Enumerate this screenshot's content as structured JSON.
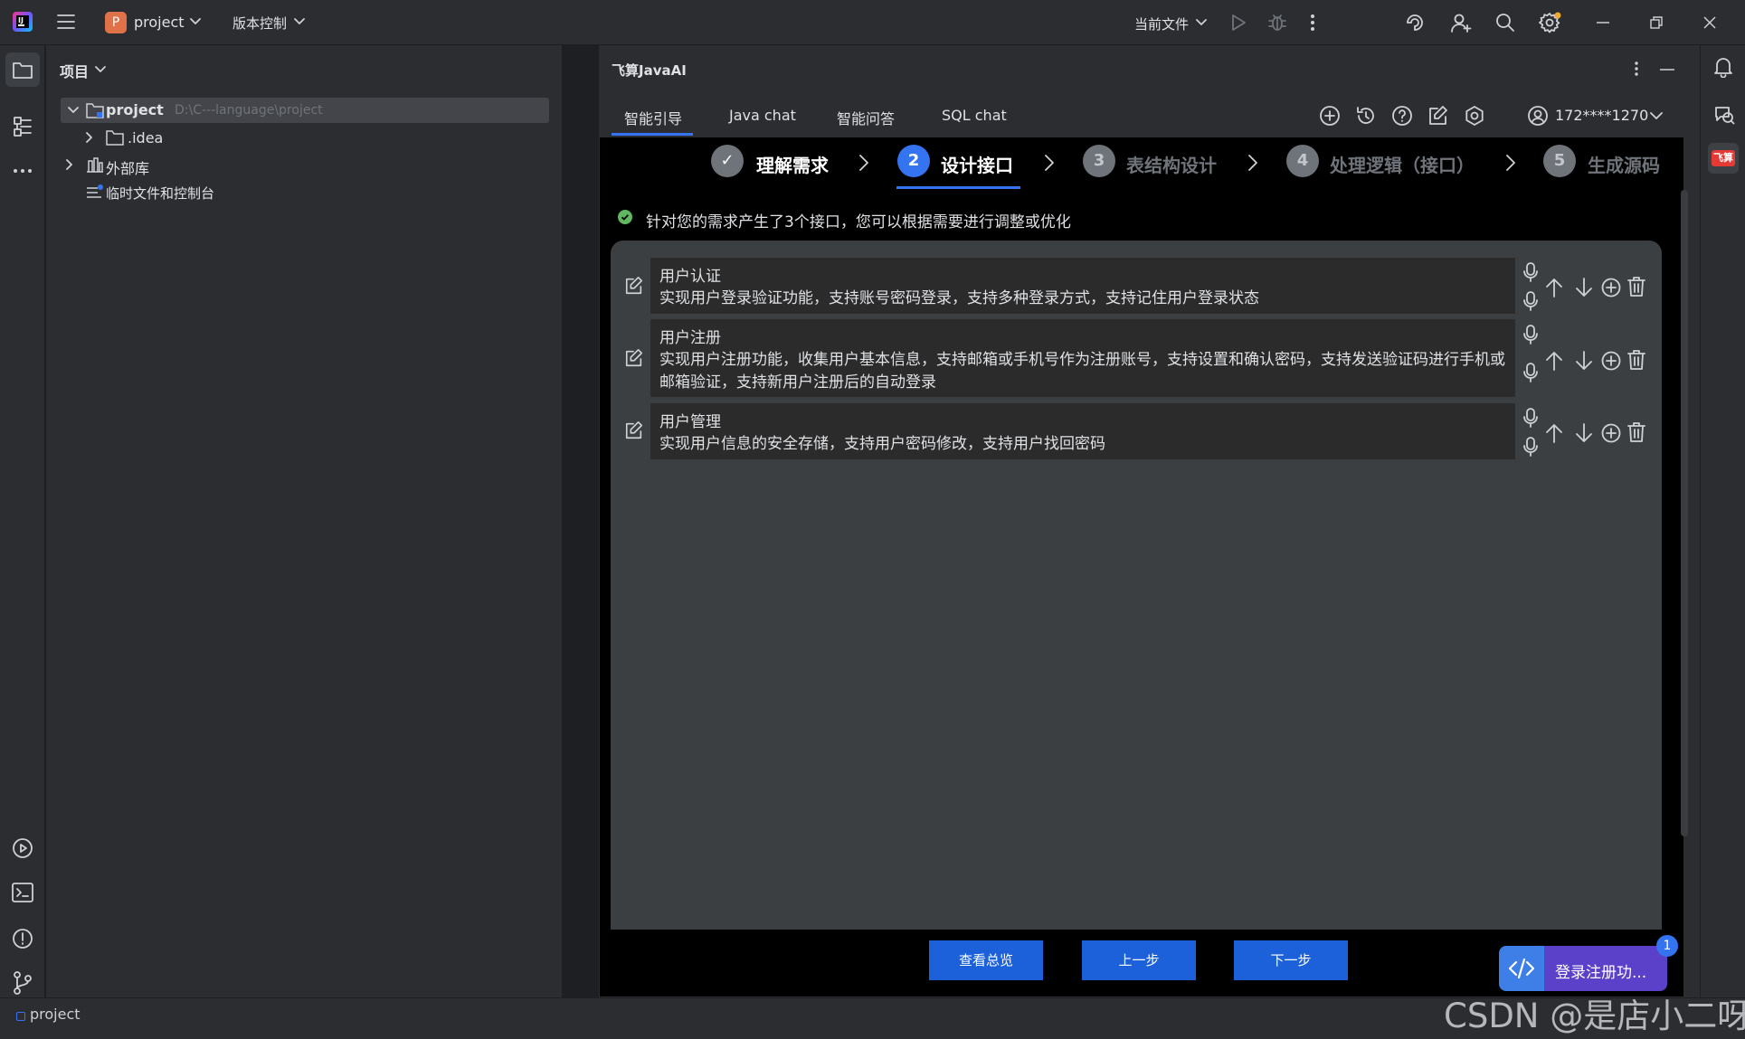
{
  "titlebar": {
    "project_badge": "P",
    "project_name": "project",
    "vcs_label": "版本控制",
    "run_config": "当前文件"
  },
  "project_panel": {
    "header": "项目",
    "tree": [
      {
        "label": "project",
        "path": "D:\\C---language\\project"
      },
      {
        "label": ".idea"
      },
      {
        "label": "外部库"
      },
      {
        "label": "临时文件和控制台"
      }
    ]
  },
  "ai_panel": {
    "title": "飞算JavaAI",
    "tabs": [
      "智能引导",
      "Java chat",
      "智能问答",
      "SQL chat"
    ],
    "active_tab": "智能引导",
    "user": "172****1270",
    "steps": [
      {
        "num": "✓",
        "label": "理解需求",
        "state": "done"
      },
      {
        "num": "2",
        "label": "设计接口",
        "state": "active"
      },
      {
        "num": "3",
        "label": "表结构设计",
        "state": "pending"
      },
      {
        "num": "4",
        "label": "处理逻辑（接口）",
        "state": "pending"
      },
      {
        "num": "5",
        "label": "生成源码",
        "state": "pending"
      }
    ],
    "notice": "针对您的需求产生了3个接口，您可以根据需要进行调整或优化",
    "interfaces": [
      {
        "title": "用户认证",
        "desc": "实现用户登录验证功能，支持账号密码登录，支持多种登录方式，支持记住用户登录状态"
      },
      {
        "title": "用户注册",
        "desc": "实现用户注册功能，收集用户基本信息，支持邮箱或手机号作为注册账号，支持设置和确认密码，支持发送验证码进行手机或邮箱验证，支持新用户注册后的自动登录"
      },
      {
        "title": "用户管理",
        "desc": "实现用户信息的安全存储，支持用户密码修改，支持用户找回密码"
      }
    ],
    "buttons": {
      "overview": "查看总览",
      "prev": "上一步",
      "next": "下一步"
    },
    "task_chip": {
      "label": "登录注册功...",
      "badge": "1"
    }
  },
  "right_strip": {
    "plugin_label": "飞算"
  },
  "statusbar": {
    "project": "project"
  },
  "watermark": "CSDN @是店小二呀",
  "colors": {
    "accent": "#1c61d9",
    "panel": "#2b2d30",
    "content": "#3c3f41"
  }
}
